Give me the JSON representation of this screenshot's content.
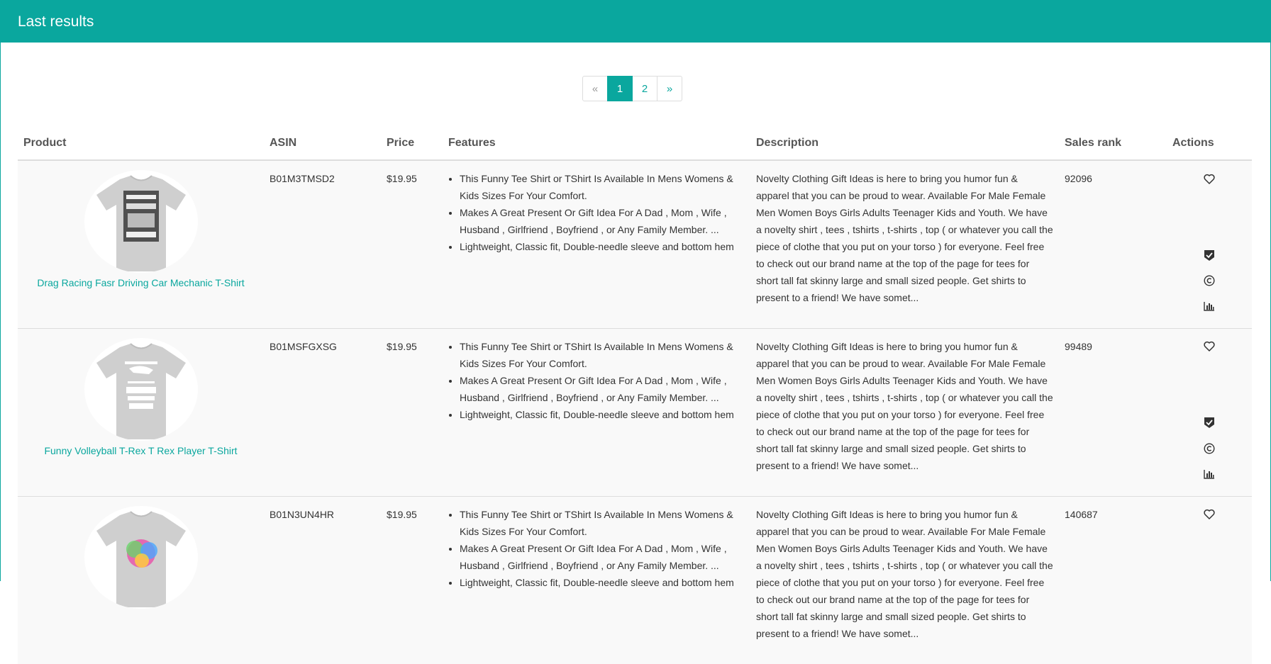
{
  "panel": {
    "title": "Last results"
  },
  "pagination": {
    "prev": "«",
    "pages": [
      "1",
      "2"
    ],
    "active": "1",
    "next": "»"
  },
  "table": {
    "headers": {
      "product": "Product",
      "asin": "ASIN",
      "price": "Price",
      "features": "Features",
      "description": "Description",
      "sales_rank": "Sales rank",
      "actions": "Actions"
    },
    "rows": [
      {
        "product_name": "Drag Racing Fasr Driving Car Mechanic T-Shirt",
        "asin": "B01M3TMSD2",
        "price": "$19.95",
        "features": [
          "This Funny Tee Shirt or TShirt Is Available In Mens Womens & Kids Sizes For Your Comfort.",
          "Makes A Great Present Or Gift Idea For A Dad , Mom , Wife , Husband , Girlfriend , Boyfriend , or Any Family Member. ...",
          "Lightweight, Classic fit, Double-needle sleeve and bottom hem"
        ],
        "description": "Novelty Clothing Gift Ideas is here to bring you humor fun & apparel that you can be proud to wear. Available For Male Female Men Women Boys Girls Adults Teenager Kids and Youth. We have a novelty shirt , tees , tshirts , t-shirts , top ( or whatever you call the piece of clothe that you put on your torso ) for everyone. Feel free to check out our brand name at the top of the page for tees for short tall fat skinny large and small sized people. Get shirts to present to a friend! We have somet...",
        "sales_rank": "92096",
        "shirt_art": "dark-text-graphic"
      },
      {
        "product_name": "Funny Volleyball T-Rex T Rex Player T-Shirt",
        "asin": "B01MSFGXSG",
        "price": "$19.95",
        "features": [
          "This Funny Tee Shirt or TShirt Is Available In Mens Womens & Kids Sizes For Your Comfort.",
          "Makes A Great Present Or Gift Idea For A Dad , Mom , Wife , Husband , Girlfriend , Boyfriend , or Any Family Member. ...",
          "Lightweight, Classic fit, Double-needle sleeve and bottom hem"
        ],
        "description": "Novelty Clothing Gift Ideas is here to bring you humor fun & apparel that you can be proud to wear. Available For Male Female Men Women Boys Girls Adults Teenager Kids and Youth. We have a novelty shirt , tees , tshirts , t-shirts , top ( or whatever you call the piece of clothe that you put on your torso ) for everyone. Feel free to check out our brand name at the top of the page for tees for short tall fat skinny large and small sized people. Get shirts to present to a friend! We have somet...",
        "sales_rank": "99489",
        "shirt_art": "trex-graphic"
      },
      {
        "product_name": "",
        "asin": "B01N3UN4HR",
        "price": "$19.95",
        "features": [
          "This Funny Tee Shirt or TShirt Is Available In Mens Womens & Kids Sizes For Your Comfort.",
          "Makes A Great Present Or Gift Idea For A Dad , Mom , Wife , Husband , Girlfriend , Boyfriend , or Any Family Member. ...",
          "Lightweight, Classic fit, Double-needle sleeve and bottom hem"
        ],
        "description": "Novelty Clothing Gift Ideas is here to bring you humor fun & apparel that you can be proud to wear. Available For Male Female Men Women Boys Girls Adults Teenager Kids and Youth. We have a novelty shirt , tees , tshirts , t-shirts , top ( or whatever you call the piece of clothe that you put on your torso ) for everyone. Feel free to check out our brand name at the top of the page for tees for short tall fat skinny large and small sized people. Get shirts to present to a friend! We have somet...",
        "sales_rank": "140687",
        "shirt_art": "rainbow-graphic"
      }
    ],
    "action_icons": [
      "heart-icon",
      "verified-shield-icon",
      "copyright-icon",
      "bar-chart-icon"
    ]
  },
  "colors": {
    "accent": "#0aa79e",
    "row_bg": "#f9f9f9",
    "border": "#dddddd",
    "shirt": "#cfcfcf"
  }
}
